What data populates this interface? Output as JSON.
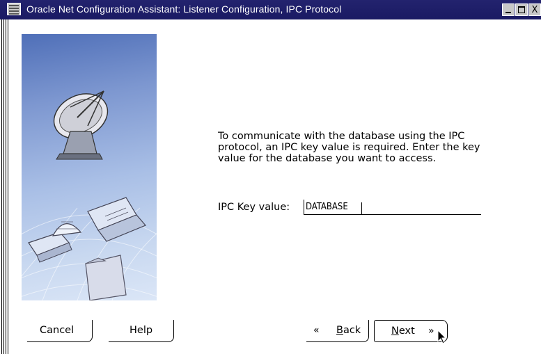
{
  "window": {
    "title": "Oracle Net Configuration Assistant: Listener Configuration, IPC Protocol",
    "controls": {
      "minimize": "minimize",
      "maximize": "maximize",
      "close": "X"
    }
  },
  "content": {
    "description": "To communicate with the database using the IPC protocol, an IPC key value is required. Enter the key value for the database you want to access.",
    "ipc_key": {
      "label": "IPC Key value:",
      "value": "DATABASE"
    }
  },
  "illustration": {
    "icons": [
      "satellite-dish-icon",
      "computer-icon",
      "laptop-icon",
      "igloo-icon",
      "folder-icon"
    ]
  },
  "buttons": {
    "cancel": "Cancel",
    "help": "Help",
    "back": "Back",
    "back_mnemonic": "B",
    "back_rest": "ack",
    "next": "Next",
    "next_mnemonic": "N",
    "next_rest": "ext",
    "back_chevron": "«",
    "next_chevron": "»"
  }
}
